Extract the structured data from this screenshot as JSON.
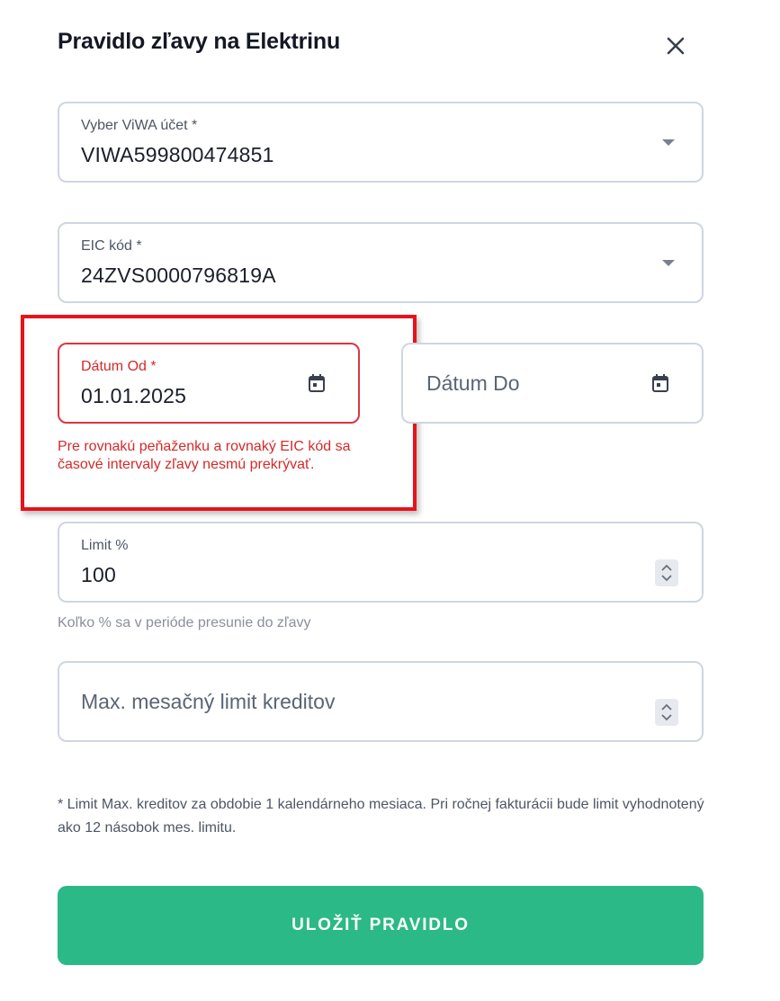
{
  "dialog": {
    "title": "Pravidlo zľavy na Elektrinu",
    "close_icon": "close-icon"
  },
  "fields": {
    "account": {
      "label": "Vyber ViWA účet *",
      "value": "VIWA599800474851",
      "icon": "chevron-down-icon"
    },
    "eic": {
      "label": "EIC kód *",
      "value": "24ZVS0000796819A",
      "icon": "chevron-down-icon"
    },
    "date_from": {
      "label": "Dátum Od *",
      "value": "01.01.2025",
      "icon": "calendar-icon",
      "error": "Pre rovnakú peňaženku a rovnaký EIC kód sa časové intervaly zľavy nesmú prekrývať."
    },
    "date_to": {
      "placeholder": "Dátum Do",
      "icon": "calendar-icon"
    },
    "limit_percent": {
      "label": "Limit %",
      "value": "100",
      "hint": "Koľko % sa v perióde presunie do zľavy",
      "icon": "stepper-icon"
    },
    "max_credits": {
      "placeholder": "Max. mesačný limit kreditov",
      "icon": "stepper-icon"
    }
  },
  "footnote": "* Limit Max. kreditov za obdobie 1 kalendárneho mesiaca. Pri ročnej fakturácii bude limit vyhodnotený ako 12 násobok mes. limitu.",
  "actions": {
    "save_label": "ULOŽIŤ PRAVIDLO"
  },
  "colors": {
    "accent": "#2ab987",
    "error": "#d42a2a",
    "highlight": "#e8121c",
    "border": "#cfd6e1"
  }
}
